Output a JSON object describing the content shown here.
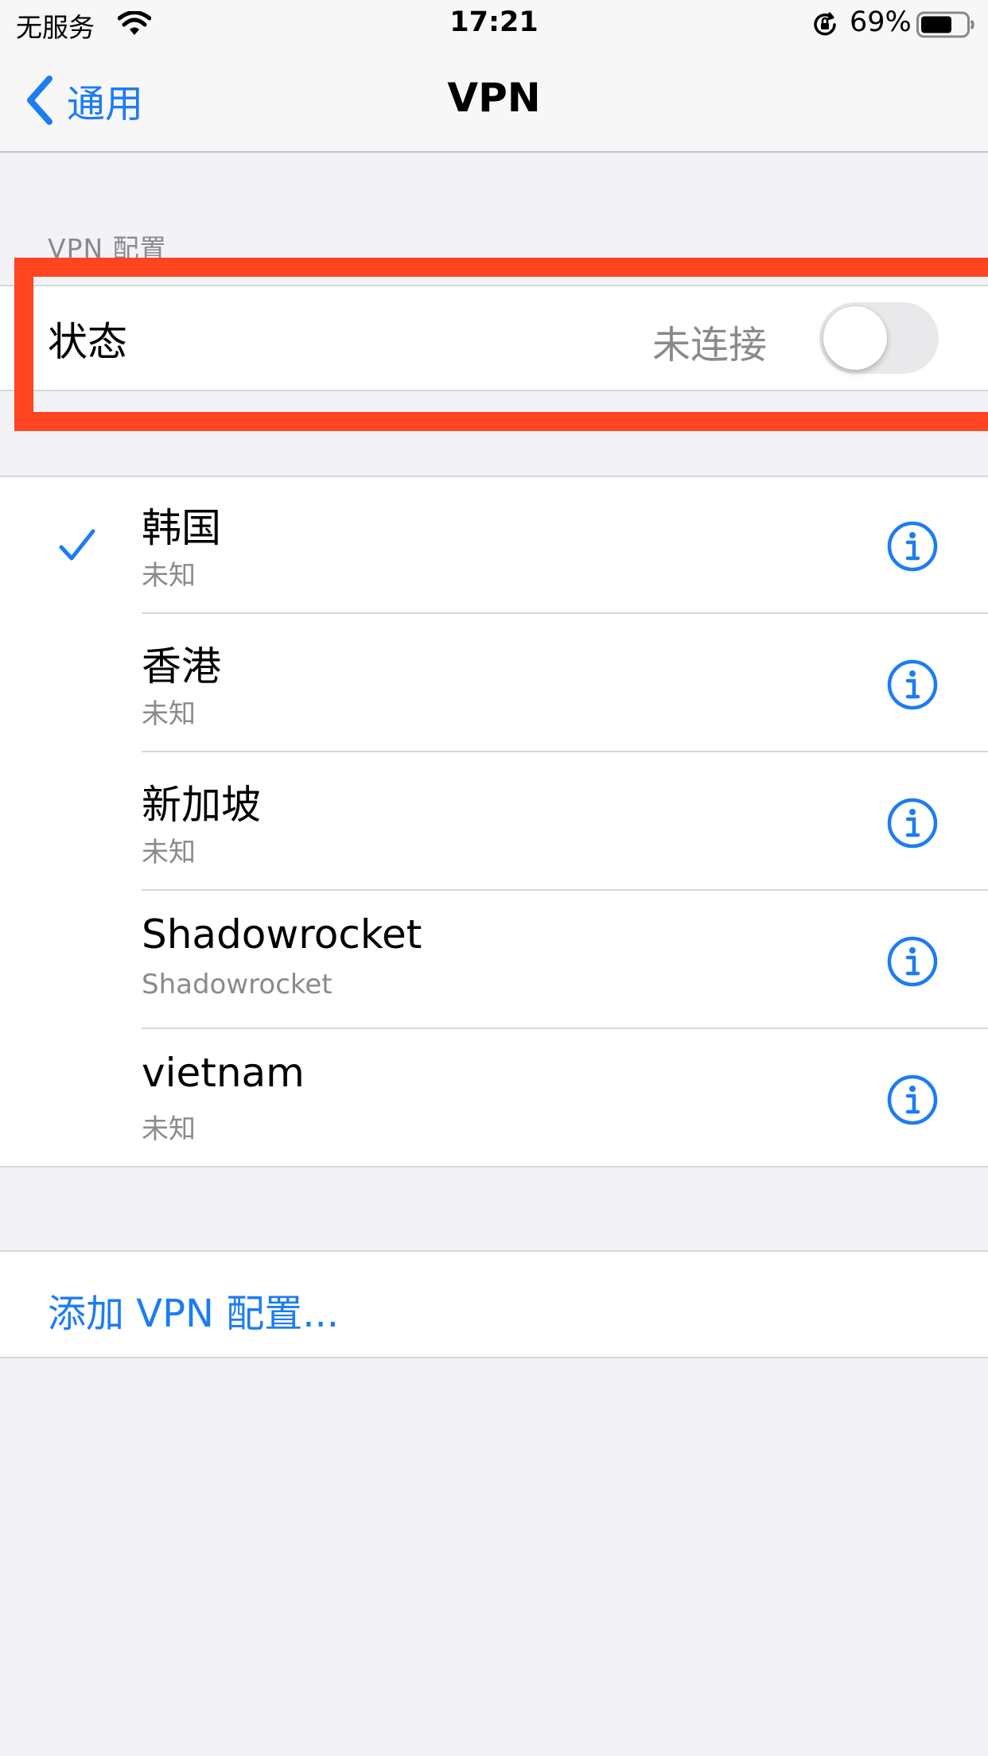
{
  "status_bar": {
    "carrier": "无服务",
    "time": "17:21",
    "battery": "69%"
  },
  "nav": {
    "back_label": "通用",
    "title": "VPN"
  },
  "section_header": "VPN 配置",
  "status_row": {
    "label": "状态",
    "value": "未连接",
    "toggle_on": false
  },
  "vpn_configs": [
    {
      "name": "韩国",
      "status": "未知",
      "selected": true
    },
    {
      "name": "香港",
      "status": "未知",
      "selected": false
    },
    {
      "name": "新加坡",
      "status": "未知",
      "selected": false
    },
    {
      "name": "Shadowrocket",
      "status": "Shadowrocket",
      "selected": false
    },
    {
      "name": "vietnam",
      "status": "未知",
      "selected": false
    }
  ],
  "add_config_label": "添加 VPN 配置...",
  "colors": {
    "accent": "#1C7CF4",
    "highlight": "#FF4422",
    "background": "#F2F2F7"
  }
}
